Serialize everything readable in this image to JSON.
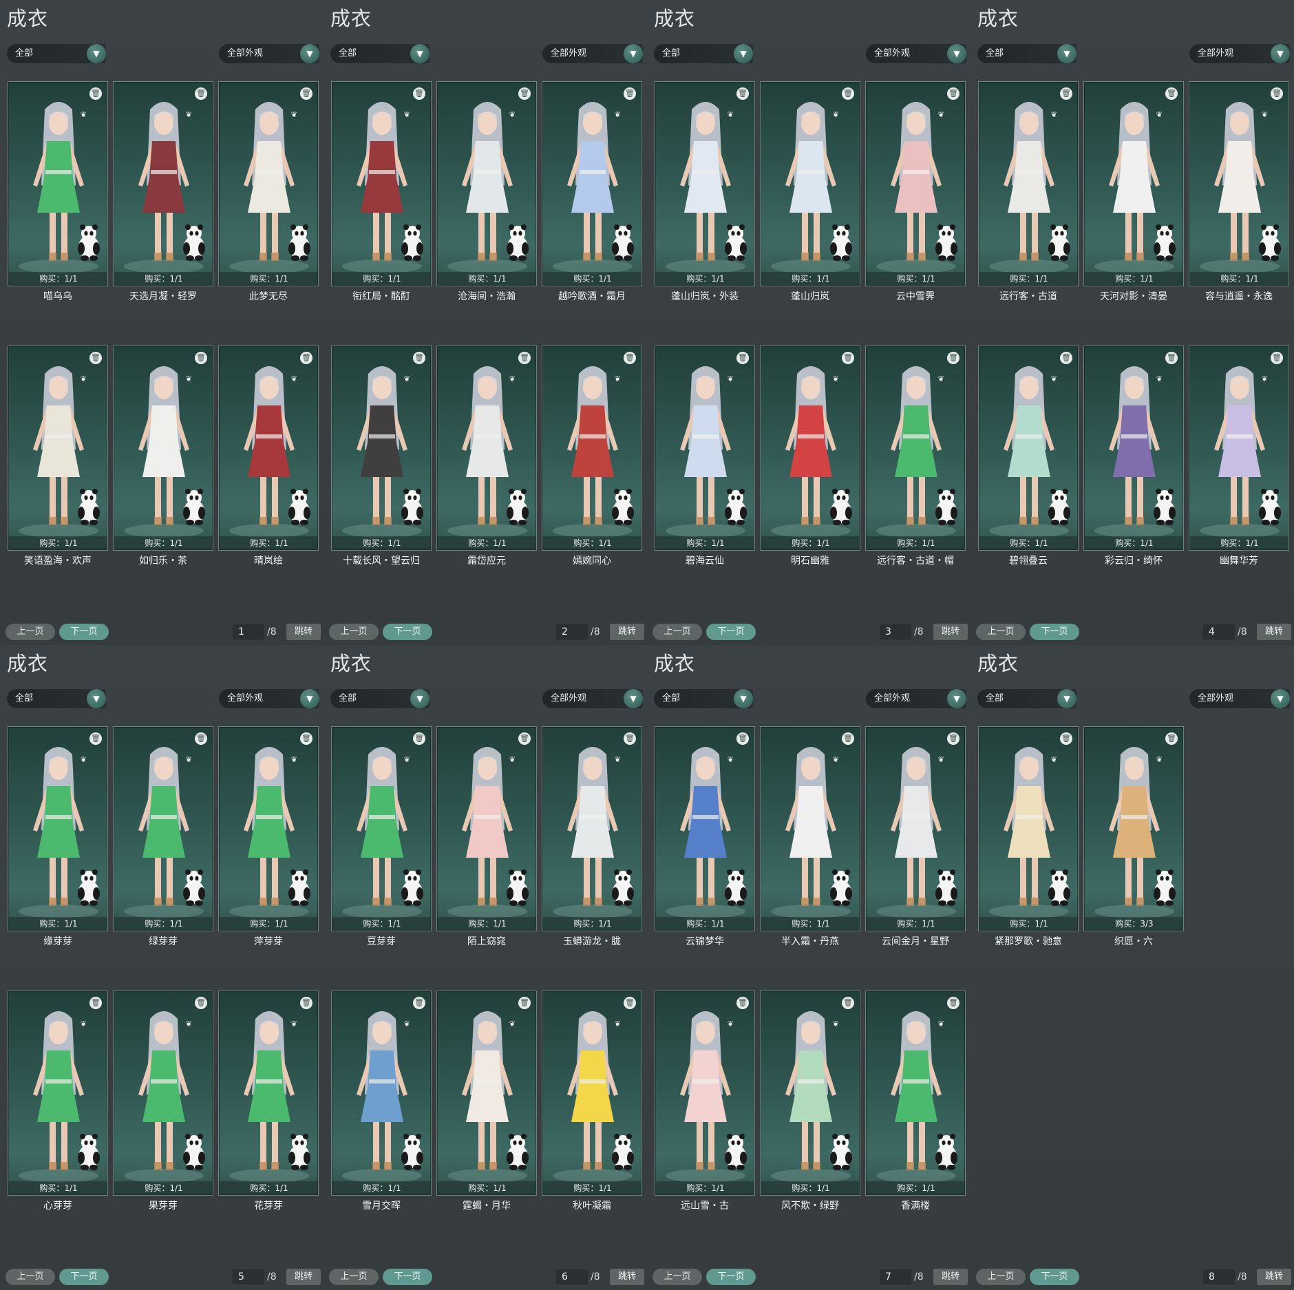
{
  "panel_title": "成衣",
  "category_select": "全部",
  "look_select": "全部外观",
  "prev_label": "上一页",
  "next_label": "下一页",
  "jump_label": "跳转",
  "total_pages": "/8",
  "colors": {
    "panel_bg": "#3a3f42",
    "card_teal": "#2f5650",
    "accent_button": "#5f9990",
    "muted_button": "#5d6665"
  },
  "icons": {
    "delete": "trash-icon",
    "dropdown": "chevron-down-icon",
    "favorite": "butterfly-icon"
  },
  "panels": [
    {
      "page": "1",
      "items": [
        {
          "name": "喵乌乌",
          "buy": "购买：1/1",
          "outfit": "#33b05a"
        },
        {
          "name": "天选月凝・轻罗",
          "buy": "购买：1/1",
          "outfit": "#7a1f25"
        },
        {
          "name": "此梦无尽",
          "buy": "购买：1/1",
          "outfit": "#e9e6dc"
        },
        {
          "name": "笑语盈海・欢声",
          "buy": "购买：1/1",
          "outfit": "#e8e2d4"
        },
        {
          "name": "如归乐・茶",
          "buy": "购买：1/1",
          "outfit": "#ededeb"
        },
        {
          "name": "晴岚绘",
          "buy": "购买：1/1",
          "outfit": "#9b1d21"
        }
      ]
    },
    {
      "page": "2",
      "items": [
        {
          "name": "衔红局・酩酊",
          "buy": "购买：1/1",
          "outfit": "#8a1e23"
        },
        {
          "name": "沧海间・浩瀚",
          "buy": "购买：1/1",
          "outfit": "#dfe5e6"
        },
        {
          "name": "越吟歌酒・霜月",
          "buy": "购买：1/1",
          "outfit": "#a9c3ea"
        },
        {
          "name": "十载长风・望云归",
          "buy": "购买：1/1",
          "outfit": "#262424"
        },
        {
          "name": "霜岱应元",
          "buy": "购买：1/1",
          "outfit": "#e4e6e6"
        },
        {
          "name": "嫣婉同心",
          "buy": "购买：1/1",
          "outfit": "#b52a22"
        }
      ]
    },
    {
      "page": "3",
      "items": [
        {
          "name": "蓬山归岚・外装",
          "buy": "购买：1/1",
          "outfit": "#dce6f0"
        },
        {
          "name": "蓬山归岚",
          "buy": "购买：1/1",
          "outfit": "#d7e3ef"
        },
        {
          "name": "云中雪霁",
          "buy": "购买：1/1",
          "outfit": "#e9b8b8"
        },
        {
          "name": "碧海云仙",
          "buy": "购买：1/1",
          "outfit": "#c9d8ee"
        },
        {
          "name": "明石幽雅",
          "buy": "购买：1/1",
          "outfit": "#cf2a2a"
        },
        {
          "name": "远行客・古道・帽",
          "buy": "购买：1/1",
          "outfit": "#33b05a"
        }
      ]
    },
    {
      "page": "4",
      "items": [
        {
          "name": "远行客・古道",
          "buy": "购买：1/1",
          "outfit": "#e6e6e2"
        },
        {
          "name": "天河对影・清晏",
          "buy": "购买：1/1",
          "outfit": "#eeeeee"
        },
        {
          "name": "容与逍遥・永逸",
          "buy": "购买：1/1",
          "outfit": "#f0ebe6"
        },
        {
          "name": "碧翎叠云",
          "buy": "购买：1/1",
          "outfit": "#a8d8c8"
        },
        {
          "name": "彩云归・绮怀",
          "buy": "购买：1/1",
          "outfit": "#6e5aa0"
        },
        {
          "name": "幽舞华芳",
          "buy": "购买：1/1",
          "outfit": "#c2b6e0"
        }
      ]
    },
    {
      "page": "5",
      "items": [
        {
          "name": "缘芽芽",
          "buy": "购买：1/1",
          "outfit": "#33b05a"
        },
        {
          "name": "绿芽芽",
          "buy": "购买：1/1",
          "outfit": "#33b05a"
        },
        {
          "name": "萍芽芽",
          "buy": "购买：1/1",
          "outfit": "#33b05a"
        },
        {
          "name": "心芽芽",
          "buy": "购买：1/1",
          "outfit": "#33b05a"
        },
        {
          "name": "果芽芽",
          "buy": "购买：1/1",
          "outfit": "#33b05a"
        },
        {
          "name": "花芽芽",
          "buy": "购买：1/1",
          "outfit": "#33b05a"
        }
      ]
    },
    {
      "page": "6",
      "items": [
        {
          "name": "豆芽芽",
          "buy": "购买：1/1",
          "outfit": "#33b05a"
        },
        {
          "name": "陌上窈窕",
          "buy": "购买：1/1",
          "outfit": "#f0c2c0"
        },
        {
          "name": "玉蟒游龙・胧",
          "buy": "购买：1/1",
          "outfit": "#e2e6e6"
        },
        {
          "name": "雪月交晖",
          "buy": "购买：1/1",
          "outfit": "#5a92c8"
        },
        {
          "name": "霆蝎・月华",
          "buy": "购买：1/1",
          "outfit": "#efe7e0"
        },
        {
          "name": "秋叶凝霜",
          "buy": "购买：1/1",
          "outfit": "#f2d230"
        }
      ]
    },
    {
      "page": "7",
      "items": [
        {
          "name": "云锦梦华",
          "buy": "购买：1/1",
          "outfit": "#3f6fc2"
        },
        {
          "name": "半入霜・丹燕",
          "buy": "购买：1/1",
          "outfit": "#eeeeee"
        },
        {
          "name": "云间金月・星野",
          "buy": "购买：1/1",
          "outfit": "#e4e6e8"
        },
        {
          "name": "远山雪・古",
          "buy": "购买：1/1",
          "outfit": "#f2cccc"
        },
        {
          "name": "风不欺・绿野",
          "buy": "购买：1/1",
          "outfit": "#a8d8b4"
        },
        {
          "name": "香满楼",
          "buy": "购买：1/1",
          "outfit": "#33b05a"
        }
      ]
    },
    {
      "page": "8",
      "items": [
        {
          "name": "紧那罗歌・驰意",
          "buy": "购买：1/1",
          "outfit": "#ecdcb4"
        },
        {
          "name": "织愿・六",
          "buy": "购买：3/3",
          "outfit": "#d8a868"
        }
      ]
    }
  ]
}
